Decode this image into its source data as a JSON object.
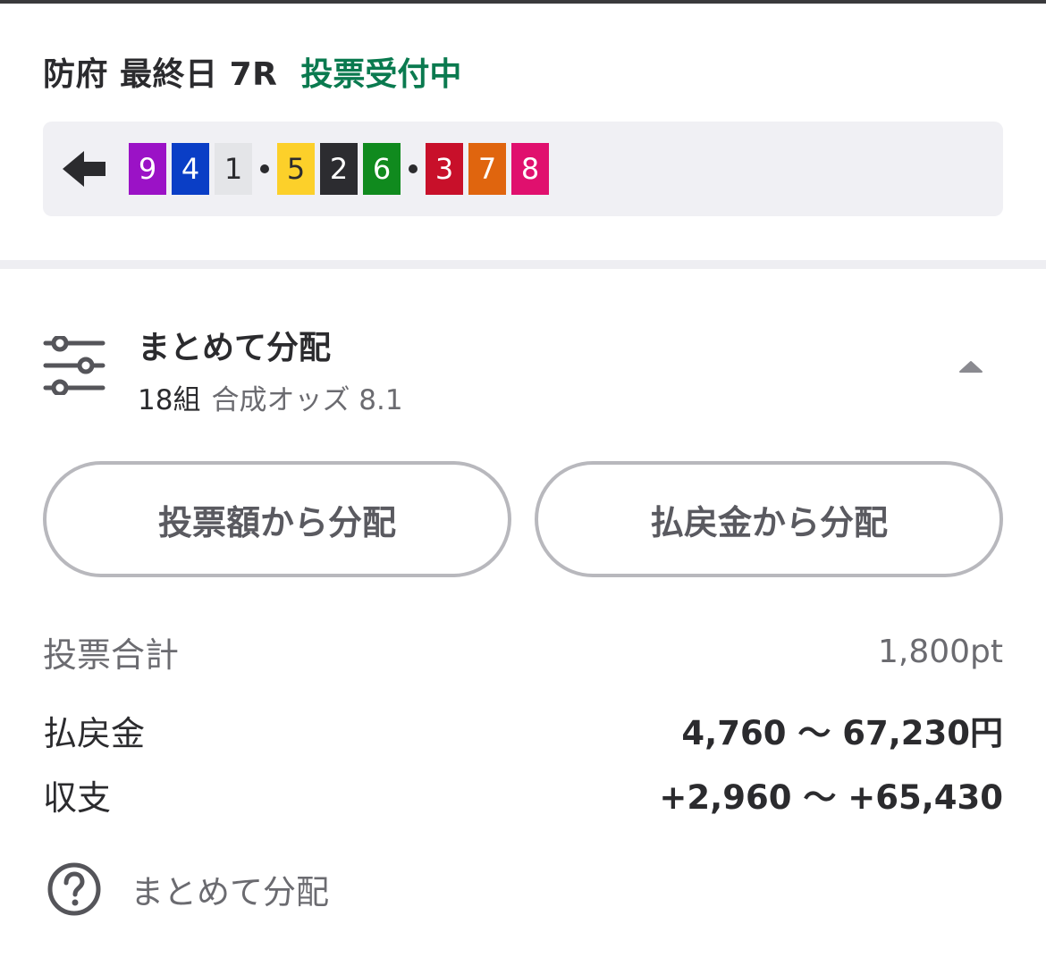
{
  "header": {
    "race_title": "防府 最終日 7R",
    "status": "投票受付中",
    "status_color": "#0a7a4f"
  },
  "selection": {
    "back_icon": "arrow-left-icon",
    "group1": [
      {
        "num": "9",
        "bg": "#9b12c6",
        "fg": "#ffffff"
      },
      {
        "num": "4",
        "bg": "#0a3ec6",
        "fg": "#ffffff"
      },
      {
        "num": "1",
        "bg": "#e4e5e8",
        "fg": "#2b2b2e"
      }
    ],
    "group2": [
      {
        "num": "5",
        "bg": "#fcd02a",
        "fg": "#2b2b2e"
      },
      {
        "num": "2",
        "bg": "#2c2c30",
        "fg": "#ffffff"
      },
      {
        "num": "6",
        "bg": "#108a1e",
        "fg": "#ffffff"
      }
    ],
    "group3": [
      {
        "num": "3",
        "bg": "#c8102a",
        "fg": "#ffffff"
      },
      {
        "num": "7",
        "bg": "#e0650e",
        "fg": "#ffffff"
      },
      {
        "num": "8",
        "bg": "#e0106e",
        "fg": "#ffffff"
      }
    ]
  },
  "distribution": {
    "icon": "sliders-icon",
    "title": "まとめて分配",
    "count": "18組",
    "odds": "合成オッズ 8.1",
    "caret_icon": "caret-up-icon"
  },
  "buttons": {
    "by_amount": "投票額から分配",
    "by_payout": "払戻金から分配"
  },
  "summary": {
    "total_label": "投票合計",
    "total_value": "1,800pt",
    "payout_label": "払戻金",
    "payout_value": "4,760 〜 67,230円",
    "balance_label": "収支",
    "balance_value": "+2,960 〜 +65,430"
  },
  "help": {
    "icon": "question-circle-icon",
    "text": "まとめて分配"
  }
}
